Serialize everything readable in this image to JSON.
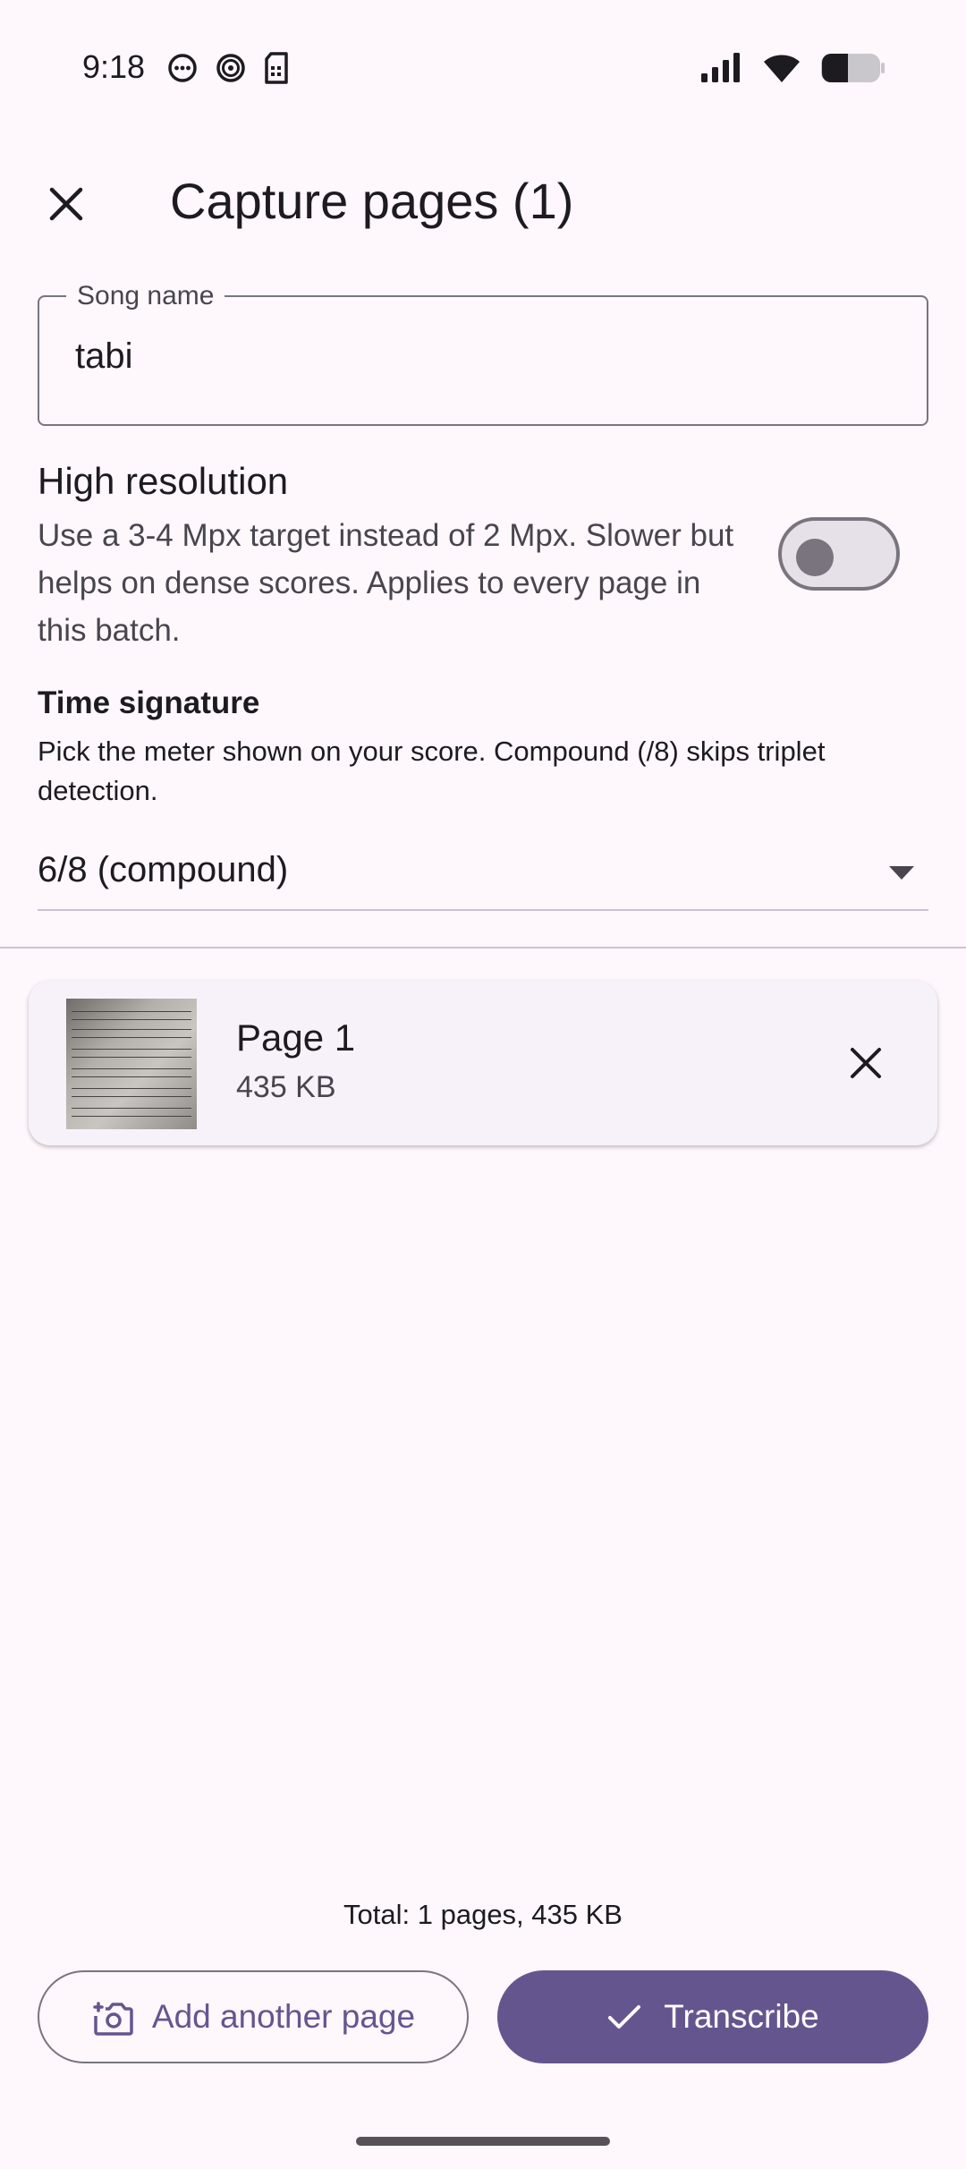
{
  "status_bar": {
    "time": "9:18",
    "left_icons": [
      "more-horiz-icon",
      "spiral-icon",
      "sim-card-icon"
    ],
    "right_icons": [
      "signal-icon",
      "wifi-icon",
      "battery-icon"
    ]
  },
  "app_bar": {
    "close_icon": "close-icon",
    "title": "Capture pages (1)"
  },
  "song_name": {
    "label": "Song name",
    "value": "tabi"
  },
  "high_resolution": {
    "title": "High resolution",
    "description": "Use a 3-4 Mpx target instead of 2 Mpx. Slower but helps on dense scores. Applies to every page in this batch.",
    "enabled": false
  },
  "time_signature": {
    "title": "Time signature",
    "description": "Pick the meter shown on your score. Compound (/8) skips triplet detection.",
    "selected": "6/8 (compound)"
  },
  "pages": [
    {
      "title": "Page 1",
      "size": "435 KB"
    }
  ],
  "footer": {
    "total": "Total: 1 pages, 435 KB",
    "add_label": "Add another page",
    "transcribe_label": "Transcribe"
  },
  "colors": {
    "background": "#fef7fc",
    "primary": "#65558f",
    "outline": "#79747e",
    "card": "#f7f2fa"
  }
}
